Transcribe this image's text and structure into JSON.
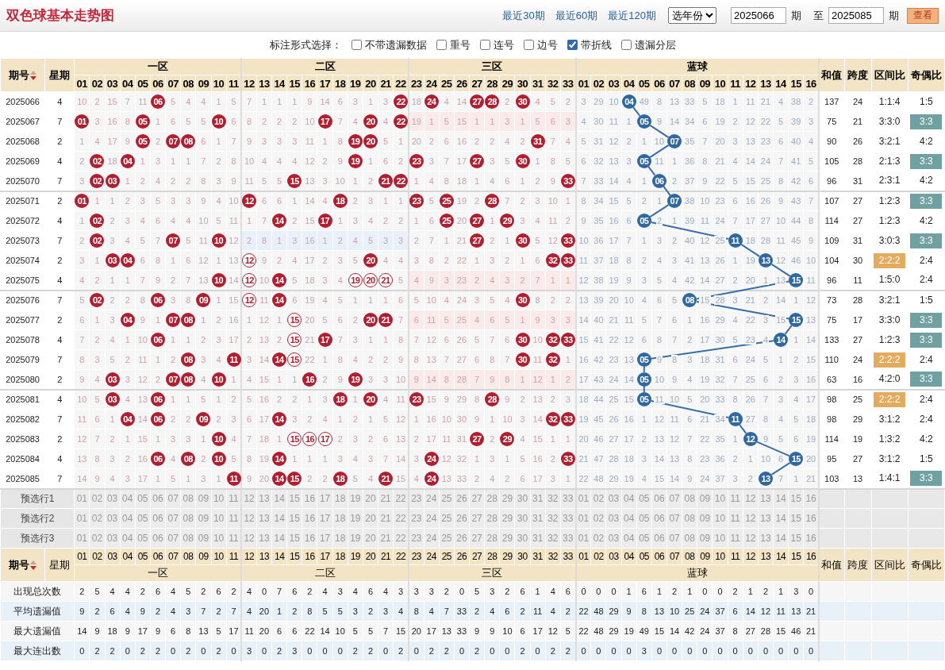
{
  "header": {
    "title": "双色球基本走势图",
    "links": [
      "最近30期",
      "最近60期",
      "最近120期"
    ],
    "year_select": "选年份",
    "from_issue": "2025066",
    "from_suffix": "期",
    "to_label": "至",
    "to_issue": "2025085",
    "to_suffix": "期",
    "view_button": "查看"
  },
  "options": {
    "label": "标注形式选择：",
    "checkboxes": [
      {
        "label": "不带遗漏数据",
        "checked": false
      },
      {
        "label": "重号",
        "checked": false
      },
      {
        "label": "连号",
        "checked": false
      },
      {
        "label": "边号",
        "checked": false
      },
      {
        "label": "带折线",
        "checked": true
      },
      {
        "label": "遗漏分层",
        "checked": false
      }
    ]
  },
  "head": {
    "issue": "期号",
    "weekday": "星期",
    "zones": [
      "一区",
      "二区",
      "三区",
      "蓝球"
    ],
    "red_numbers": [
      "01",
      "02",
      "03",
      "04",
      "05",
      "06",
      "07",
      "08",
      "09",
      "10",
      "11",
      "12",
      "13",
      "14",
      "15",
      "16",
      "17",
      "18",
      "19",
      "20",
      "21",
      "22",
      "23",
      "24",
      "25",
      "26",
      "27",
      "28",
      "29",
      "30",
      "31",
      "32",
      "33"
    ],
    "blue_numbers": [
      "01",
      "02",
      "03",
      "04",
      "05",
      "06",
      "07",
      "08",
      "09",
      "10",
      "11",
      "12",
      "13",
      "14",
      "15",
      "16"
    ],
    "sum": "和值",
    "span": "跨度",
    "zone_ratio": "区间比",
    "odd_even": "奇偶比"
  },
  "rows": [
    {
      "issue": "2025066",
      "weekday": "4",
      "red": [
        "10",
        "2",
        "15",
        "7",
        "11",
        {
          "ball": "06",
          "outlined": false
        },
        "5",
        "4",
        "4",
        "1",
        "5",
        "7",
        "1",
        "1",
        "1",
        "9",
        "14",
        "6",
        "3",
        "1",
        "3",
        {
          "ball": "22",
          "outlined": false
        },
        "18",
        {
          "ball": "24",
          "outlined": false
        },
        "4",
        "14",
        {
          "ball": "27",
          "outlined": false
        },
        {
          "ball": "28",
          "outlined": false
        },
        "2",
        {
          "ball": "30",
          "outlined": false
        },
        "4",
        "5",
        "2"
      ],
      "blue": [
        "3",
        "29",
        "10",
        {
          "ball": "04",
          "outlined": false
        },
        "49",
        "8",
        "13",
        "33",
        "5",
        "18",
        "1",
        "11",
        "21",
        "4",
        "38",
        "2"
      ],
      "sum": "137",
      "span": "24",
      "zone_ratio": {
        "text": "1:1:4",
        "highlight": false
      },
      "odd_even": {
        "text": "1:5",
        "highlight": false
      }
    },
    {
      "issue": "2025067",
      "weekday": "7",
      "red": [
        {
          "ball": "01",
          "outlined": false
        },
        "3",
        "16",
        "8",
        {
          "ball": "05",
          "outlined": false
        },
        "1",
        "6",
        "5",
        "5",
        {
          "ball": "10",
          "outlined": false
        },
        "6",
        "8",
        "2",
        "2",
        "2",
        "10",
        {
          "ball": "17",
          "outlined": false
        },
        "7",
        "4",
        {
          "ball": "20",
          "outlined": false
        },
        "4",
        {
          "ball": "22",
          "outlined": false
        },
        "19",
        "1",
        "5",
        "15",
        "1",
        "1",
        "3",
        "1",
        "5",
        "6",
        "3"
      ],
      "blue": [
        "4",
        "30",
        "11",
        "1",
        {
          "ball": "05",
          "outlined": false
        },
        "9",
        "14",
        "34",
        "6",
        "19",
        "2",
        "12",
        "22",
        "5",
        "39",
        "3"
      ],
      "sum": "75",
      "span": "21",
      "zone_ratio": {
        "text": "3:3:0",
        "highlight": false
      },
      "odd_even": {
        "text": "3:3",
        "highlight": true
      }
    },
    {
      "issue": "2025068",
      "weekday": "2",
      "red": [
        "1",
        "4",
        "17",
        "9",
        {
          "ball": "05",
          "outlined": false
        },
        "2",
        {
          "ball": "07",
          "outlined": false
        },
        {
          "ball": "08",
          "outlined": false
        },
        "6",
        "1",
        "7",
        "9",
        "3",
        "3",
        "3",
        "11",
        "1",
        "8",
        {
          "ball": "19",
          "outlined": false
        },
        {
          "ball": "20",
          "outlined": false
        },
        "5",
        "1",
        "20",
        "2",
        "6",
        "16",
        "2",
        "2",
        "4",
        "2",
        {
          "ball": "31",
          "outlined": false
        },
        "7",
        "4"
      ],
      "blue": [
        "5",
        "31",
        "12",
        "2",
        "1",
        "10",
        {
          "ball": "07",
          "outlined": false
        },
        "35",
        "7",
        "20",
        "3",
        "13",
        "23",
        "6",
        "40",
        "4"
      ],
      "sum": "90",
      "span": "26",
      "zone_ratio": {
        "text": "3:2:1",
        "highlight": false
      },
      "odd_even": {
        "text": "4:2",
        "highlight": false
      }
    },
    {
      "issue": "2025069",
      "weekday": "4",
      "red": [
        "2",
        {
          "ball": "02",
          "outlined": false
        },
        "18",
        {
          "ball": "04",
          "outlined": false
        },
        "1",
        "3",
        "1",
        "1",
        "7",
        "2",
        "8",
        "10",
        "4",
        "4",
        "4",
        "12",
        "2",
        "9",
        {
          "ball": "19",
          "outlined": false
        },
        "1",
        "6",
        "2",
        {
          "ball": "23",
          "outlined": false
        },
        "3",
        "7",
        "17",
        {
          "ball": "27",
          "outlined": false
        },
        "3",
        "5",
        {
          "ball": "30",
          "outlined": false
        },
        "1",
        "8",
        "5"
      ],
      "blue": [
        "6",
        "32",
        "13",
        "3",
        {
          "ball": "05",
          "outlined": false
        },
        "11",
        "1",
        "36",
        "8",
        "21",
        "4",
        "14",
        "24",
        "7",
        "41",
        "5"
      ],
      "sum": "105",
      "span": "28",
      "zone_ratio": {
        "text": "2:1:3",
        "highlight": false
      },
      "odd_even": {
        "text": "3:3",
        "highlight": true
      }
    },
    {
      "issue": "2025070",
      "weekday": "7",
      "red": [
        "3",
        {
          "ball": "02",
          "outlined": false
        },
        {
          "ball": "03",
          "outlined": false
        },
        "1",
        "2",
        "4",
        "2",
        "2",
        "8",
        "3",
        "9",
        "11",
        "5",
        "5",
        {
          "ball": "15",
          "outlined": false
        },
        "13",
        "3",
        "10",
        "1",
        "2",
        {
          "ball": "21",
          "outlined": false
        },
        {
          "ball": "22",
          "outlined": false
        },
        "1",
        "4",
        "8",
        "18",
        "1",
        "4",
        "6",
        "1",
        "2",
        "9",
        {
          "ball": "33",
          "outlined": false
        }
      ],
      "blue": [
        "7",
        "33",
        "14",
        "4",
        "1",
        {
          "ball": "06",
          "outlined": false
        },
        "2",
        "37",
        "9",
        "22",
        "5",
        "15",
        "25",
        "8",
        "42",
        "6"
      ],
      "sum": "96",
      "span": "31",
      "zone_ratio": {
        "text": "2:3:1",
        "highlight": false
      },
      "odd_even": {
        "text": "4:2",
        "highlight": false
      }
    },
    {
      "issue": "2025071",
      "weekday": "2",
      "red": [
        {
          "ball": "01",
          "outlined": false
        },
        "1",
        "1",
        "2",
        "3",
        "5",
        "3",
        "3",
        "9",
        "4",
        "10",
        {
          "ball": "12",
          "outlined": false
        },
        "6",
        "6",
        "1",
        "14",
        "4",
        {
          "ball": "18",
          "outlined": false
        },
        "2",
        "3",
        "1",
        "1",
        {
          "ball": "23",
          "outlined": false
        },
        "5",
        {
          "ball": "25",
          "outlined": false
        },
        "19",
        "2",
        {
          "ball": "28",
          "outlined": false
        },
        "7",
        "2",
        "3",
        "10",
        "1"
      ],
      "blue": [
        "8",
        "34",
        "15",
        "5",
        "2",
        "1",
        {
          "ball": "07",
          "outlined": false
        },
        "38",
        "10",
        "23",
        "6",
        "16",
        "26",
        "9",
        "43",
        "7"
      ],
      "sum": "107",
      "span": "27",
      "zone_ratio": {
        "text": "1:2:3",
        "highlight": false
      },
      "odd_even": {
        "text": "3:3",
        "highlight": true
      }
    },
    {
      "issue": "2025072",
      "weekday": "4",
      "red": [
        "1",
        {
          "ball": "02",
          "outlined": false
        },
        "2",
        "3",
        "4",
        "6",
        "4",
        "4",
        "10",
        "5",
        "11",
        "1",
        "7",
        {
          "ball": "14",
          "outlined": false
        },
        "2",
        "15",
        {
          "ball": "17",
          "outlined": false
        },
        "1",
        "3",
        "4",
        "2",
        "2",
        "1",
        "6",
        {
          "ball": "25",
          "outlined": false
        },
        "20",
        {
          "ball": "27",
          "outlined": false
        },
        "1",
        {
          "ball": "29",
          "outlined": false
        },
        "3",
        "4",
        "11",
        "2"
      ],
      "blue": [
        "9",
        "35",
        "16",
        "6",
        {
          "ball": "05",
          "outlined": false
        },
        "2",
        "1",
        "39",
        "11",
        "24",
        "7",
        "17",
        "27",
        "10",
        "44",
        "8"
      ],
      "sum": "114",
      "span": "27",
      "zone_ratio": {
        "text": "1:2:3",
        "highlight": false
      },
      "odd_even": {
        "text": "4:2",
        "highlight": false
      }
    },
    {
      "issue": "2025073",
      "weekday": "7",
      "red": [
        "2",
        {
          "ball": "02",
          "outlined": false
        },
        "3",
        "4",
        "5",
        "7",
        {
          "ball": "07",
          "outlined": false
        },
        "5",
        "11",
        {
          "ball": "10",
          "outlined": false
        },
        "12",
        "2",
        "8",
        "1",
        "3",
        "16",
        "1",
        "2",
        "4",
        "5",
        "3",
        "3",
        "2",
        "7",
        "1",
        "21",
        {
          "ball": "27",
          "outlined": false
        },
        "2",
        "1",
        {
          "ball": "30",
          "outlined": false
        },
        "5",
        "12",
        {
          "ball": "33",
          "outlined": false
        }
      ],
      "blue": [
        "10",
        "36",
        "17",
        "7",
        "1",
        "3",
        "2",
        "40",
        "12",
        "25",
        {
          "ball": "11",
          "outlined": false
        },
        "18",
        "28",
        "11",
        "45",
        "9"
      ],
      "sum": "109",
      "span": "31",
      "zone_ratio": {
        "text": "3:0:3",
        "highlight": false
      },
      "odd_even": {
        "text": "3:3",
        "highlight": true
      }
    },
    {
      "issue": "2025074",
      "weekday": "2",
      "red": [
        "3",
        "1",
        {
          "ball": "03",
          "outlined": false
        },
        {
          "ball": "04",
          "outlined": false
        },
        "6",
        "8",
        "1",
        "6",
        "12",
        "1",
        "13",
        {
          "ball": "12",
          "outlined": true
        },
        "9",
        "2",
        "4",
        "17",
        "2",
        "3",
        "5",
        {
          "ball": "20",
          "outlined": false
        },
        "4",
        "4",
        "3",
        "8",
        "2",
        "22",
        "1",
        "3",
        "2",
        "1",
        "6",
        {
          "ball": "32",
          "outlined": false
        },
        {
          "ball": "33",
          "outlined": false
        }
      ],
      "blue": [
        "11",
        "37",
        "18",
        "8",
        "2",
        "4",
        "3",
        "41",
        "13",
        "26",
        "1",
        "19",
        {
          "ball": "13",
          "outlined": false
        },
        "12",
        "46",
        "10"
      ],
      "sum": "104",
      "span": "30",
      "zone_ratio": {
        "text": "2:2:2",
        "highlight": true
      },
      "odd_even": {
        "text": "2:4",
        "highlight": false
      }
    },
    {
      "issue": "2025075",
      "weekday": "4",
      "red": [
        "4",
        "2",
        "1",
        "1",
        "7",
        "9",
        "2",
        "7",
        "13",
        {
          "ball": "10",
          "outlined": false
        },
        "14",
        {
          "ball": "12",
          "outlined": true
        },
        "10",
        {
          "ball": "14",
          "outlined": false
        },
        "5",
        "18",
        "3",
        "4",
        {
          "ball": "19",
          "outlined": true
        },
        {
          "ball": "20",
          "outlined": true
        },
        {
          "ball": "21",
          "outlined": true
        },
        "5",
        "4",
        "9",
        "3",
        "23",
        "2",
        "4",
        "3",
        "2",
        "7",
        "1",
        "1"
      ],
      "blue": [
        "12",
        "38",
        "19",
        "9",
        "3",
        "5",
        "4",
        "42",
        "14",
        "27",
        "2",
        "20",
        "1",
        "13",
        {
          "ball": "15",
          "outlined": false
        },
        "11"
      ],
      "sum": "96",
      "span": "11",
      "zone_ratio": {
        "text": "1:5:0",
        "highlight": false
      },
      "odd_even": {
        "text": "2:4",
        "highlight": false
      }
    },
    {
      "issue": "2025076",
      "weekday": "7",
      "red": [
        "5",
        {
          "ball": "02",
          "outlined": false
        },
        "2",
        "2",
        "8",
        {
          "ball": "06",
          "outlined": false
        },
        "3",
        "8",
        {
          "ball": "09",
          "outlined": false
        },
        "1",
        "15",
        {
          "ball": "12",
          "outlined": true
        },
        "11",
        {
          "ball": "14",
          "outlined": false
        },
        "6",
        "19",
        "4",
        "5",
        "1",
        "1",
        "1",
        "6",
        "5",
        "10",
        "4",
        "24",
        "3",
        "5",
        "4",
        {
          "ball": "30",
          "outlined": false
        },
        "8",
        "2",
        "2"
      ],
      "blue": [
        "13",
        "39",
        "20",
        "10",
        "4",
        "6",
        "5",
        {
          "ball": "08",
          "outlined": false
        },
        "15",
        "28",
        "3",
        "21",
        "2",
        "14",
        "1",
        "12"
      ],
      "sum": "73",
      "span": "28",
      "zone_ratio": {
        "text": "3:2:1",
        "highlight": false
      },
      "odd_even": {
        "text": "1:5",
        "highlight": false
      }
    },
    {
      "issue": "2025077",
      "weekday": "2",
      "red": [
        "6",
        "1",
        "3",
        {
          "ball": "04",
          "outlined": false
        },
        "9",
        "1",
        {
          "ball": "07",
          "outlined": false
        },
        {
          "ball": "08",
          "outlined": false
        },
        "1",
        "2",
        "16",
        "1",
        "12",
        "1",
        {
          "ball": "15",
          "outlined": true
        },
        "20",
        "5",
        "6",
        "2",
        {
          "ball": "20",
          "outlined": false
        },
        {
          "ball": "21",
          "outlined": false
        },
        "7",
        "6",
        "11",
        "5",
        "25",
        "4",
        "6",
        "5",
        "1",
        "9",
        "3",
        "3"
      ],
      "blue": [
        "14",
        "40",
        "21",
        "11",
        "5",
        "7",
        "6",
        "1",
        "16",
        "29",
        "4",
        "22",
        "3",
        "15",
        {
          "ball": "15",
          "outlined": false
        },
        "13"
      ],
      "sum": "75",
      "span": "17",
      "zone_ratio": {
        "text": "3:3:0",
        "highlight": false
      },
      "odd_even": {
        "text": "3:3",
        "highlight": true
      }
    },
    {
      "issue": "2025078",
      "weekday": "4",
      "red": [
        "7",
        "2",
        "4",
        "1",
        "10",
        {
          "ball": "06",
          "outlined": false
        },
        "1",
        "1",
        "2",
        "3",
        "17",
        "2",
        "13",
        "2",
        {
          "ball": "15",
          "outlined": true
        },
        "21",
        {
          "ball": "17",
          "outlined": false
        },
        "7",
        "3",
        "1",
        "1",
        "8",
        "7",
        "12",
        "6",
        "26",
        "5",
        "7",
        "6",
        {
          "ball": "30",
          "outlined": false
        },
        "10",
        {
          "ball": "32",
          "outlined": false
        },
        {
          "ball": "33",
          "outlined": false
        }
      ],
      "blue": [
        "15",
        "41",
        "22",
        "12",
        "6",
        "8",
        "7",
        "2",
        "17",
        "30",
        "5",
        "23",
        "4",
        {
          "ball": "14",
          "outlined": false
        },
        "1",
        "14"
      ],
      "sum": "133",
      "span": "27",
      "zone_ratio": {
        "text": "1:2:3",
        "highlight": false
      },
      "odd_even": {
        "text": "3:3",
        "highlight": true
      }
    },
    {
      "issue": "2025079",
      "weekday": "7",
      "red": [
        "8",
        "3",
        "5",
        "2",
        "11",
        "1",
        "2",
        {
          "ball": "08",
          "outlined": false
        },
        "3",
        "4",
        {
          "ball": "11",
          "outlined": false
        },
        "3",
        "14",
        {
          "ball": "14",
          "outlined": false
        },
        {
          "ball": "15",
          "outlined": true
        },
        "22",
        "1",
        "8",
        "4",
        "2",
        "2",
        "9",
        "8",
        "13",
        "7",
        "27",
        "6",
        "8",
        "7",
        {
          "ball": "30",
          "outlined": false
        },
        "11",
        {
          "ball": "32",
          "outlined": false
        },
        "1"
      ],
      "blue": [
        "16",
        "42",
        "23",
        "13",
        {
          "ball": "05",
          "outlined": false
        },
        "9",
        "8",
        "3",
        "18",
        "31",
        "6",
        "24",
        "5",
        "1",
        "2",
        "15"
      ],
      "sum": "110",
      "span": "24",
      "zone_ratio": {
        "text": "2:2:2",
        "highlight": true
      },
      "odd_even": {
        "text": "2:4",
        "highlight": false
      }
    },
    {
      "issue": "2025080",
      "weekday": "2",
      "red": [
        "9",
        "4",
        {
          "ball": "03",
          "outlined": false
        },
        "3",
        "12",
        "2",
        {
          "ball": "07",
          "outlined": false
        },
        {
          "ball": "08",
          "outlined": false
        },
        "4",
        {
          "ball": "10",
          "outlined": false
        },
        "1",
        "4",
        "15",
        "1",
        "1",
        {
          "ball": "16",
          "outlined": false
        },
        "2",
        "9",
        {
          "ball": "19",
          "outlined": false
        },
        "3",
        "3",
        "10",
        "9",
        "14",
        "8",
        "28",
        "7",
        "9",
        "8",
        "1",
        "12",
        "1",
        "2"
      ],
      "blue": [
        "17",
        "43",
        "24",
        "14",
        {
          "ball": "05",
          "outlined": false
        },
        "10",
        "9",
        "4",
        "19",
        "32",
        "7",
        "25",
        "6",
        "2",
        "3",
        "16"
      ],
      "sum": "63",
      "span": "16",
      "zone_ratio": {
        "text": "4:2:0",
        "highlight": false
      },
      "odd_even": {
        "text": "3:3",
        "highlight": true
      }
    },
    {
      "issue": "2025081",
      "weekday": "4",
      "red": [
        "10",
        "5",
        {
          "ball": "03",
          "outlined": false
        },
        "4",
        "13",
        {
          "ball": "06",
          "outlined": false
        },
        "1",
        "1",
        "5",
        "1",
        "2",
        "5",
        "16",
        "2",
        "2",
        "1",
        "3",
        {
          "ball": "18",
          "outlined": false
        },
        "1",
        {
          "ball": "20",
          "outlined": false
        },
        "4",
        "11",
        {
          "ball": "23",
          "outlined": false
        },
        "15",
        "9",
        "29",
        "8",
        {
          "ball": "28",
          "outlined": false
        },
        "9",
        "2",
        "13",
        "2",
        "3"
      ],
      "blue": [
        "18",
        "44",
        "25",
        "15",
        {
          "ball": "05",
          "outlined": false
        },
        "11",
        "10",
        "5",
        "20",
        "33",
        "8",
        "26",
        "7",
        "3",
        "4",
        "17"
      ],
      "sum": "98",
      "span": "25",
      "zone_ratio": {
        "text": "2:2:2",
        "highlight": true
      },
      "odd_even": {
        "text": "2:4",
        "highlight": false
      }
    },
    {
      "issue": "2025082",
      "weekday": "7",
      "red": [
        "11",
        "6",
        "1",
        {
          "ball": "04",
          "outlined": false
        },
        "14",
        {
          "ball": "06",
          "outlined": false
        },
        "2",
        "2",
        {
          "ball": "09",
          "outlined": false
        },
        "2",
        "3",
        "6",
        "17",
        {
          "ball": "14",
          "outlined": false
        },
        "3",
        "2",
        "4",
        "1",
        "2",
        "1",
        "5",
        "12",
        "1",
        "16",
        "10",
        "30",
        "9",
        "1",
        "10",
        "3",
        "14",
        {
          "ball": "32",
          "outlined": false
        },
        {
          "ball": "33",
          "outlined": false
        }
      ],
      "blue": [
        "19",
        "45",
        "26",
        "16",
        "1",
        "12",
        "11",
        "6",
        "21",
        "34",
        {
          "ball": "11",
          "outlined": false
        },
        "27",
        "8",
        "4",
        "5",
        "18"
      ],
      "sum": "98",
      "span": "29",
      "zone_ratio": {
        "text": "3:1:2",
        "highlight": false
      },
      "odd_even": {
        "text": "2:4",
        "highlight": false
      }
    },
    {
      "issue": "2025083",
      "weekday": "2",
      "red": [
        "12",
        "7",
        "2",
        "1",
        "15",
        "1",
        "3",
        "3",
        "1",
        {
          "ball": "10",
          "outlined": false
        },
        "4",
        "7",
        "18",
        "1",
        {
          "ball": "15",
          "outlined": true
        },
        {
          "ball": "16",
          "outlined": true
        },
        {
          "ball": "17",
          "outlined": true
        },
        "2",
        "3",
        "2",
        "6",
        "13",
        "2",
        "17",
        "11",
        "31",
        {
          "ball": "27",
          "outlined": false
        },
        "2",
        {
          "ball": "29",
          "outlined": false
        },
        "4",
        "15",
        "1",
        "1"
      ],
      "blue": [
        "20",
        "46",
        "27",
        "17",
        "2",
        "13",
        "12",
        "7",
        "22",
        "35",
        "1",
        {
          "ball": "12",
          "outlined": false
        },
        "9",
        "5",
        "6",
        "19"
      ],
      "sum": "114",
      "span": "19",
      "zone_ratio": {
        "text": "1:3:2",
        "highlight": false
      },
      "odd_even": {
        "text": "4:2",
        "highlight": false
      }
    },
    {
      "issue": "2025084",
      "weekday": "4",
      "red": [
        "13",
        "8",
        "3",
        "2",
        "16",
        {
          "ball": "06",
          "outlined": false
        },
        "4",
        {
          "ball": "08",
          "outlined": false
        },
        "2",
        {
          "ball": "10",
          "outlined": false
        },
        "5",
        "8",
        "19",
        {
          "ball": "14",
          "outlined": false
        },
        "1",
        "1",
        "1",
        "3",
        "4",
        "3",
        "7",
        "14",
        "3",
        {
          "ball": "24",
          "outlined": false
        },
        "12",
        "32",
        "1",
        "3",
        "1",
        "5",
        "16",
        "2",
        {
          "ball": "33",
          "outlined": false
        }
      ],
      "blue": [
        "21",
        "47",
        "28",
        "18",
        "3",
        "14",
        "13",
        "8",
        "23",
        "36",
        "2",
        "1",
        "10",
        "6",
        {
          "ball": "15",
          "outlined": false
        },
        "20"
      ],
      "sum": "95",
      "span": "27",
      "zone_ratio": {
        "text": "3:1:2",
        "highlight": false
      },
      "odd_even": {
        "text": "1:5",
        "highlight": false
      }
    },
    {
      "issue": "2025085",
      "weekday": "7",
      "red": [
        "14",
        "9",
        "4",
        "3",
        "17",
        "1",
        "5",
        "1",
        "3",
        "1",
        {
          "ball": "11",
          "outlined": false
        },
        "9",
        "20",
        {
          "ball": "14",
          "outlined": false
        },
        {
          "ball": "15",
          "outlined": false
        },
        "2",
        "2",
        {
          "ball": "18",
          "outlined": false
        },
        "5",
        "4",
        {
          "ball": "21",
          "outlined": false
        },
        "15",
        "4",
        {
          "ball": "24",
          "outlined": false
        },
        "13",
        "33",
        "2",
        "4",
        "2",
        "6",
        "17",
        "3",
        "1"
      ],
      "blue": [
        "22",
        "48",
        "29",
        "19",
        "4",
        "15",
        "14",
        "9",
        "24",
        "37",
        "3",
        "2",
        {
          "ball": "13",
          "outlined": false
        },
        "7",
        "1",
        "21"
      ],
      "sum": "103",
      "span": "13",
      "zone_ratio": {
        "text": "1:4:1",
        "highlight": false
      },
      "odd_even": {
        "text": "3:3",
        "highlight": true
      }
    }
  ],
  "preselect": [
    {
      "label": "预选行1",
      "red": [
        "01",
        "02",
        "03",
        "04",
        "05",
        "06",
        "07",
        "08",
        "09",
        "10",
        "11",
        "12",
        "13",
        "14",
        "15",
        "16",
        "17",
        "18",
        "19",
        "20",
        "21",
        "22",
        "23",
        "24",
        "25",
        "26",
        "27",
        "28",
        "29",
        "30",
        "31",
        "32",
        "33"
      ],
      "blue": [
        "01",
        "02",
        "03",
        "04",
        "05",
        "06",
        "07",
        "08",
        "09",
        "10",
        "11",
        "12",
        "13",
        "14",
        "15",
        "16"
      ]
    },
    {
      "label": "预选行2",
      "red": [
        "01",
        "02",
        "03",
        "04",
        "05",
        "06",
        "07",
        "08",
        "09",
        "10",
        "11",
        "12",
        "13",
        "14",
        "15",
        "16",
        "17",
        "18",
        "19",
        "20",
        "21",
        "22",
        "23",
        "24",
        "25",
        "26",
        "27",
        "28",
        "29",
        "30",
        "31",
        "32",
        "33"
      ],
      "blue": [
        "01",
        "02",
        "03",
        "04",
        "05",
        "06",
        "07",
        "08",
        "09",
        "10",
        "11",
        "12",
        "13",
        "14",
        "15",
        "16"
      ]
    },
    {
      "label": "预选行3",
      "red": [
        "01",
        "02",
        "03",
        "04",
        "05",
        "06",
        "07",
        "08",
        "09",
        "10",
        "11",
        "12",
        "13",
        "14",
        "15",
        "16",
        "17",
        "18",
        "19",
        "20",
        "21",
        "22",
        "23",
        "24",
        "25",
        "26",
        "27",
        "28",
        "29",
        "30",
        "31",
        "32",
        "33"
      ],
      "blue": [
        "01",
        "02",
        "03",
        "04",
        "05",
        "06",
        "07",
        "08",
        "09",
        "10",
        "11",
        "12",
        "13",
        "14",
        "15",
        "16"
      ]
    }
  ],
  "foot_head": {
    "issue": "期号",
    "weekday": "星期",
    "zones": [
      "一区",
      "二区",
      "三区",
      "蓝球"
    ],
    "red_numbers": [
      "01",
      "02",
      "03",
      "04",
      "05",
      "06",
      "07",
      "08",
      "09",
      "10",
      "11",
      "12",
      "13",
      "14",
      "15",
      "16",
      "17",
      "18",
      "19",
      "20",
      "21",
      "22",
      "23",
      "24",
      "25",
      "26",
      "27",
      "28",
      "29",
      "30",
      "31",
      "32",
      "33"
    ],
    "blue_numbers": [
      "01",
      "02",
      "03",
      "04",
      "05",
      "06",
      "07",
      "08",
      "09",
      "10",
      "11",
      "12",
      "13",
      "14",
      "15",
      "16"
    ],
    "sum": "和值",
    "span": "跨度",
    "zone_ratio": "区间比",
    "odd_even": "奇偶比"
  },
  "stats": [
    {
      "label": "出现总次数",
      "red": [
        "2",
        "5",
        "4",
        "4",
        "2",
        "6",
        "4",
        "5",
        "2",
        "6",
        "2",
        "4",
        "0",
        "7",
        "6",
        "2",
        "4",
        "3",
        "4",
        "6",
        "4",
        "3",
        "3",
        "3",
        "2",
        "0",
        "5",
        "3",
        "2",
        "6",
        "1",
        "4",
        "6"
      ],
      "blue": [
        "0",
        "0",
        "0",
        "1",
        "6",
        "1",
        "2",
        "1",
        "0",
        "0",
        "2",
        "1",
        "2",
        "1",
        "3",
        "0"
      ]
    },
    {
      "label": "平均遗漏值",
      "red": [
        "9",
        "2",
        "6",
        "4",
        "9",
        "2",
        "4",
        "3",
        "7",
        "2",
        "7",
        "4",
        "20",
        "1",
        "2",
        "8",
        "5",
        "5",
        "3",
        "2",
        "3",
        "4",
        "8",
        "4",
        "7",
        "33",
        "2",
        "4",
        "6",
        "2",
        "11",
        "4",
        "2"
      ],
      "blue": [
        "22",
        "48",
        "29",
        "9",
        "8",
        "13",
        "10",
        "25",
        "24",
        "37",
        "6",
        "14",
        "12",
        "11",
        "13",
        "21"
      ]
    },
    {
      "label": "最大遗漏值",
      "red": [
        "14",
        "9",
        "18",
        "9",
        "17",
        "9",
        "6",
        "8",
        "13",
        "5",
        "17",
        "11",
        "20",
        "6",
        "6",
        "22",
        "14",
        "10",
        "5",
        "5",
        "7",
        "15",
        "20",
        "17",
        "13",
        "33",
        "9",
        "9",
        "10",
        "6",
        "17",
        "12",
        "5"
      ],
      "blue": [
        "22",
        "48",
        "29",
        "19",
        "49",
        "15",
        "14",
        "42",
        "24",
        "37",
        "8",
        "27",
        "28",
        "15",
        "46",
        "21"
      ]
    },
    {
      "label": "最大连出数",
      "red": [
        "0",
        "2",
        "2",
        "0",
        "2",
        "2",
        "0",
        "2",
        "0",
        "2",
        "0",
        "3",
        "0",
        "2",
        "3",
        "0",
        "0",
        "0",
        "2",
        "2",
        "0",
        "2",
        "0",
        "2",
        "2",
        "0",
        "2",
        "0",
        "0",
        "2",
        "0",
        "2",
        "2"
      ],
      "blue": [
        "0",
        "0",
        "0",
        "0",
        "3",
        "0",
        "0",
        "0",
        "0",
        "0",
        "0",
        "0",
        "0",
        "0",
        "0",
        "0"
      ]
    }
  ]
}
